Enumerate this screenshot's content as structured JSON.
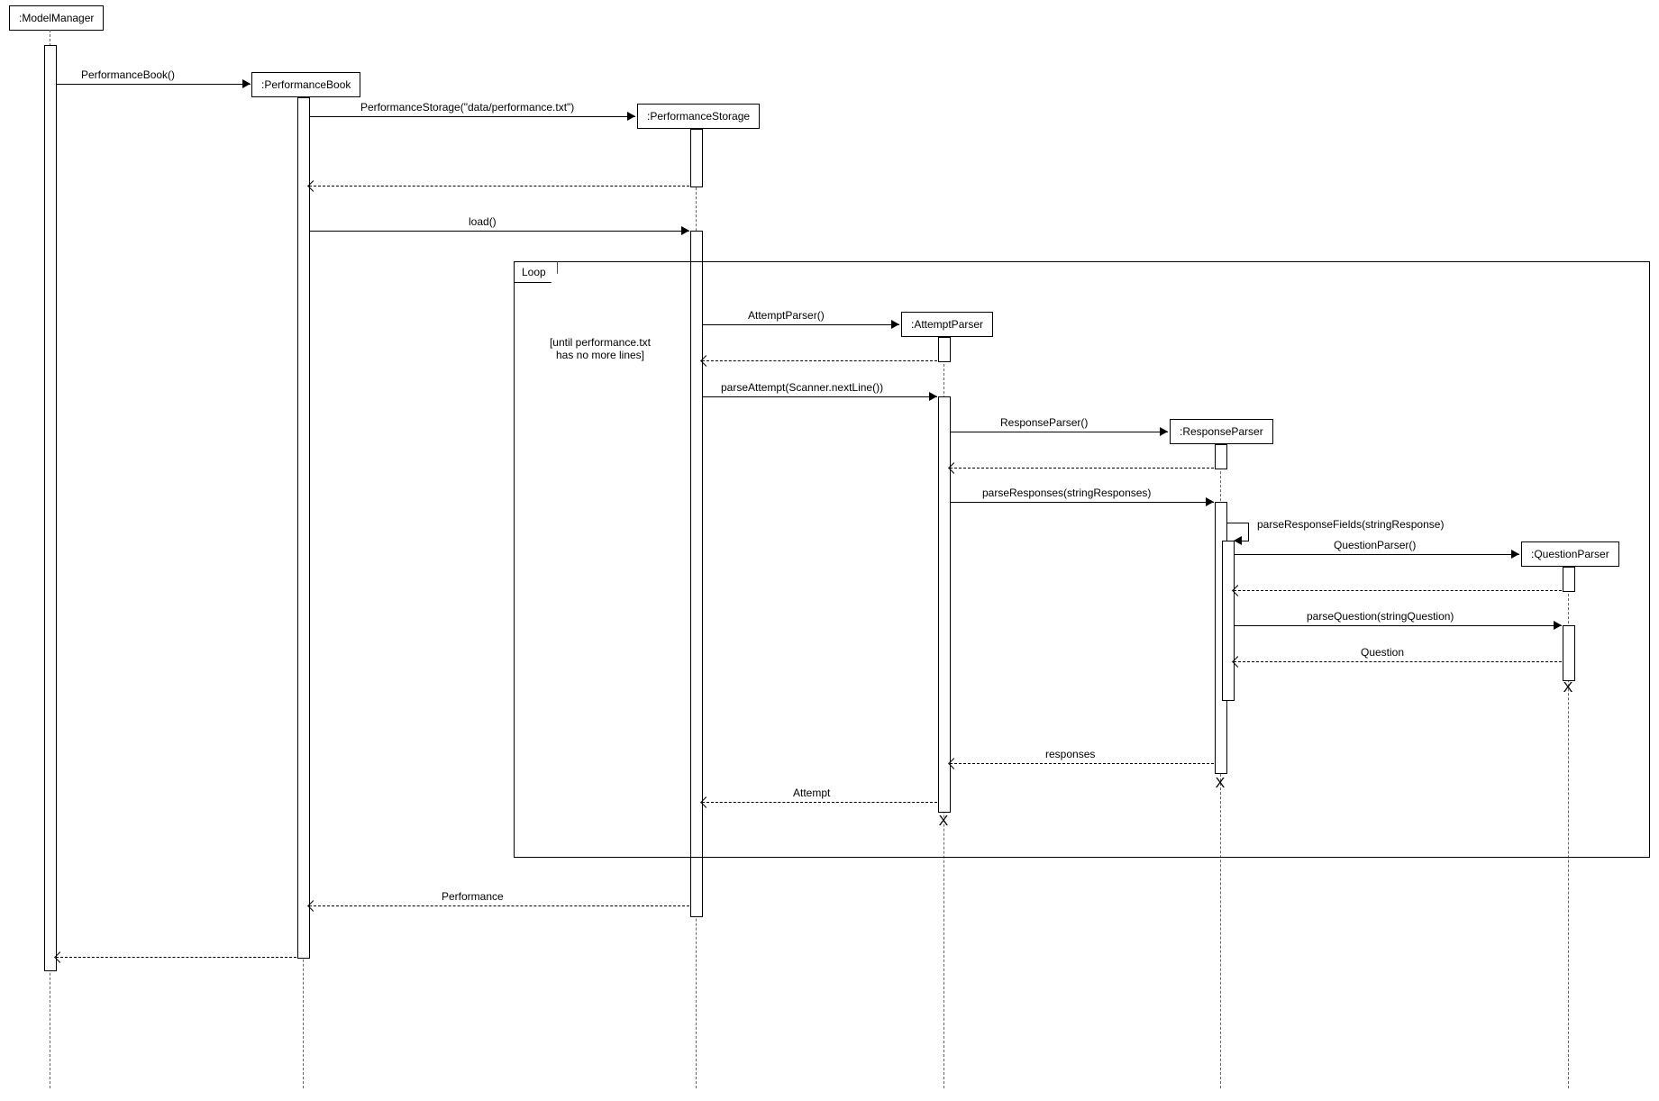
{
  "lifelines": {
    "model_manager": ":ModelManager",
    "performance_book": ":PerformanceBook",
    "performance_storage": ":PerformanceStorage",
    "attempt_parser": ":AttemptParser",
    "response_parser": ":ResponseParser",
    "question_parser": ":QuestionParser"
  },
  "messages": {
    "m1": "PerformanceBook()",
    "m2": "PerformanceStorage(\"data/performance.txt\")",
    "m3": "load()",
    "m4": "AttemptParser()",
    "m5": "parseAttempt(Scanner.nextLine())",
    "m6": "ResponseParser()",
    "m7": "parseResponses(stringResponses)",
    "m8": "parseResponseFields(stringResponse)",
    "m9": "QuestionParser()",
    "m10": "parseQuestion(stringQuestion)",
    "r1": "Question",
    "r2": "responses",
    "r3": "Attempt",
    "r4": "Performance"
  },
  "fragment": {
    "label": "Loop",
    "guard": "[until performance.txt\nhas no more lines]"
  }
}
